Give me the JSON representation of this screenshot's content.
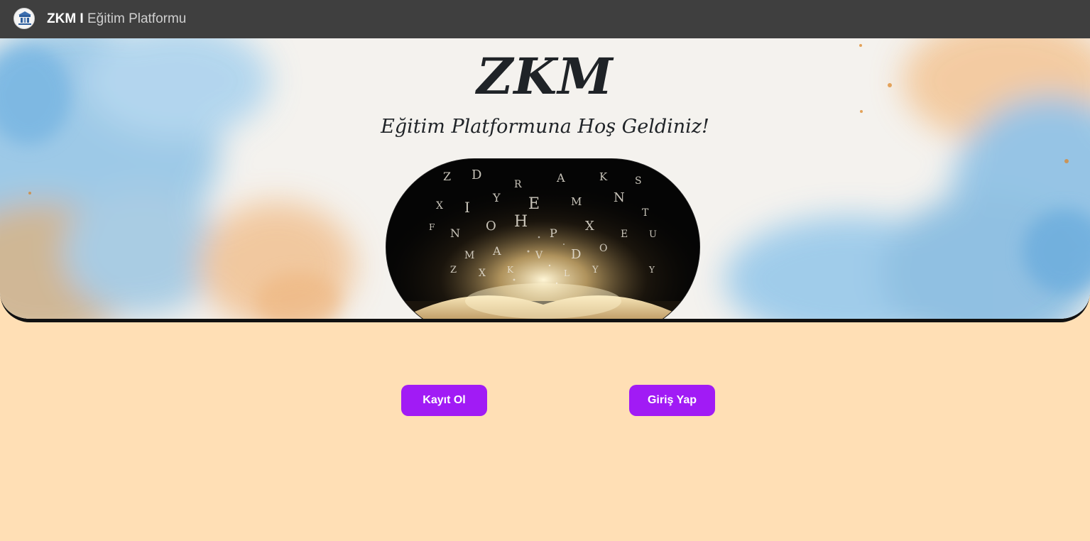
{
  "navbar": {
    "brand_strong": "ZKM I",
    "brand_light": " Eğitim Platformu",
    "logo_icon": "school-logo-icon",
    "background": "#3f3f3f"
  },
  "hero": {
    "title": "ZKM",
    "subtitle": "Eğitim Platformuna Hoş Geldiniz!",
    "image_icon": "open-book-magic-letters-image"
  },
  "actions": {
    "register_label": "Kayıt Ol",
    "login_label": "Giriş Yap",
    "accent": "#a11bf5"
  },
  "page": {
    "background": "#ffdfb5"
  }
}
